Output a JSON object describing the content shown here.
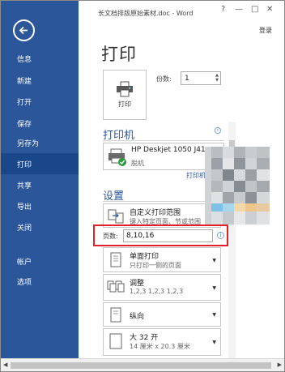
{
  "window": {
    "title": "长文档排版原始素材.doc - Word",
    "help": "?",
    "minimize": "—",
    "restore": "□",
    "close": "✕",
    "login": "登录"
  },
  "nav": {
    "back_icon": "back-arrow-icon",
    "items": [
      {
        "label": "信息"
      },
      {
        "label": "新建"
      },
      {
        "label": "打开"
      },
      {
        "label": "保存"
      },
      {
        "label": "另存为"
      },
      {
        "label": "打印",
        "active": true
      },
      {
        "label": "共享"
      },
      {
        "label": "导出"
      },
      {
        "label": "关闭"
      },
      {
        "label": "帐户"
      },
      {
        "label": "选项"
      }
    ],
    "bg_color": "#2b579a",
    "active_color": "#19478a"
  },
  "main": {
    "heading": "打印",
    "print_button": "打印",
    "copies_label": "份数:",
    "copies_value": "1",
    "printer_section": "打印机",
    "printer_name": "HP Deskjet 1050 J41...",
    "printer_status": "脱机",
    "printer_properties": "打印机属性",
    "settings_section": "设置",
    "settings": [
      {
        "line1": "自定义打印范围",
        "line2": "键入特定页面、节或范围",
        "icon": "page-range-icon"
      },
      {
        "line1": "单面打印",
        "line2": "只打印一侧的页面",
        "icon": "one-sided-icon"
      },
      {
        "line1": "调整",
        "line2": "1,2,3    1,2,3    1,2,3",
        "icon": "collated-icon"
      },
      {
        "line1": "纵向",
        "line2": "",
        "icon": "portrait-icon"
      },
      {
        "line1": "大 32 开",
        "line2": "14 厘米 x 20.3 厘米",
        "icon": "paper-size-icon"
      }
    ],
    "pages_label": "页数:",
    "pages_value": "8,10,16",
    "info_icon": "ⓘ",
    "highlight_color": "#e3202a"
  }
}
